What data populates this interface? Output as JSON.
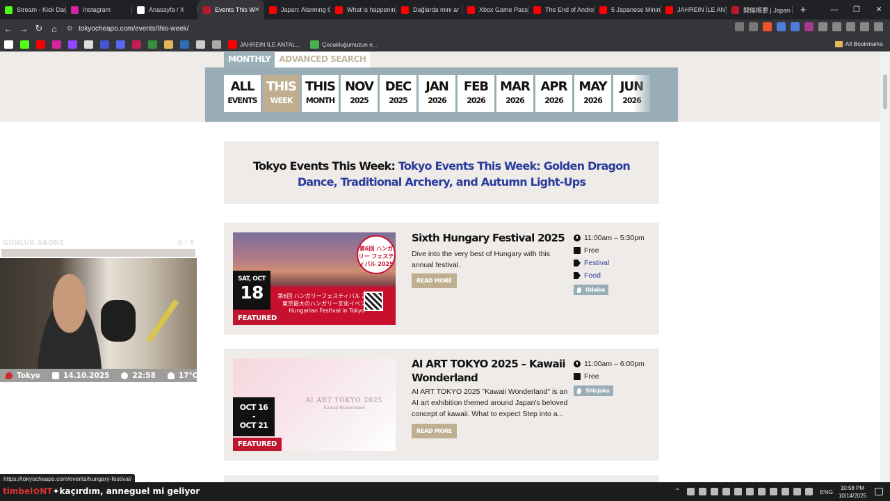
{
  "browser": {
    "tabs": [
      {
        "label": "Stream - Kick Das",
        "fav": "#53fc18"
      },
      {
        "label": "Instagram",
        "fav": "#d6249f"
      },
      {
        "label": "Anasayfa / X",
        "fav": "#ffffff"
      },
      {
        "label": "Events This W",
        "fav": "#c0152f",
        "active": true
      },
      {
        "label": "Japan: Alarming C",
        "fav": "#ff0000"
      },
      {
        "label": "What is happenin",
        "fav": "#ff0000"
      },
      {
        "label": "Dağlarda mini ar",
        "fav": "#ff0000"
      },
      {
        "label": "Xbox Game Pass",
        "fav": "#ff0000"
      },
      {
        "label": "The End of Andro",
        "fav": "#ff0000"
      },
      {
        "label": "5 Japanese Minim",
        "fav": "#ff0000"
      },
      {
        "label": "JAHREIN İLE ANTI",
        "fav": "#ff0000"
      },
      {
        "label": "開催概要 | Japan",
        "fav": "#c0152f"
      }
    ],
    "url": "tokyocheapo.com/events/this-week/",
    "bookmarks": [
      {
        "label": "JAHREIN İLE ANTAL...",
        "fav": "#ff0000"
      },
      {
        "label": "Çocukluğumuzun e...",
        "fav": "#4caf50"
      }
    ],
    "all_bookmarks": "All Bookmarks",
    "status_url": "https://tokyocheapo.com/events/hungary-festival/"
  },
  "page": {
    "view_tabs": [
      "MONTHLY",
      "ADVANCED SEARCH"
    ],
    "date_tabs": [
      {
        "big": "ALL",
        "small": "EVENTS"
      },
      {
        "big": "THIS",
        "small": "WEEK",
        "selected": true
      },
      {
        "big": "THIS",
        "small": "MONTH"
      },
      {
        "big": "NOV",
        "small": "2025"
      },
      {
        "big": "DEC",
        "small": "2025"
      },
      {
        "big": "JAN",
        "small": "2026"
      },
      {
        "big": "FEB",
        "small": "2026"
      },
      {
        "big": "MAR",
        "small": "2026"
      },
      {
        "big": "APR",
        "small": "2026"
      },
      {
        "big": "MAY",
        "small": "2026"
      },
      {
        "big": "JUN",
        "small": "2026"
      }
    ],
    "heading_prefix": "Tokyo Events This Week: ",
    "heading_link": "Tokyo Events This Week: Golden Dragon Dance, Traditional Archery, and Autumn Light-Ups",
    "events": [
      {
        "title": "Sixth Hungary Festival 2025",
        "description": "Dive into the very best of Hungary with this annual festival.",
        "date_dow": "SAT, OCT",
        "date_day": "18",
        "featured": "FEATURED",
        "read_more": "READ MORE",
        "time": "11:00am – 5:30pm",
        "price": "Free",
        "tags": [
          "Festival",
          "Food"
        ],
        "location": "Odaiba",
        "image_circle": "第6回 ハンガリー フェスティバル 2025",
        "image_text": "第6回 ハンガリーフェスティバル 2025 東京最大のハンガリー文化イベント Hungarian Festival in Tokyo"
      },
      {
        "title": "AI ART TOKYO 2025 – Kawaii Wonderland",
        "description": "AI ART TOKYO 2025 \"Kawaii Wonderland\" is an AI art exhibition themed around Japan's beloved concept of kawaii. What to expect Step into a...",
        "date_from": "OCT 16",
        "date_sep": "-",
        "date_to": "OCT 21",
        "featured": "FEATURED",
        "read_more": "READ MORE",
        "time": "11:00am – 6:00pm",
        "price": "Free",
        "location": "Shinjuku",
        "image_title": "AI ART TOKYO 2025",
        "image_sub": "Kawaii Wonderland"
      }
    ]
  },
  "overlay": {
    "label": "GÜNLÜK ABONE",
    "count": "0 / 5",
    "city": "Tokyo",
    "date": "14.10.2025",
    "time": "22:58",
    "temp": "17°C"
  },
  "taskbar": {
    "ticker_red": "timbel✿NT",
    "ticker": "✦kaçırdım, anneguel mi geliyor",
    "lang": "ENG",
    "time": "10:58 PM",
    "date": "10/14/2025"
  }
}
